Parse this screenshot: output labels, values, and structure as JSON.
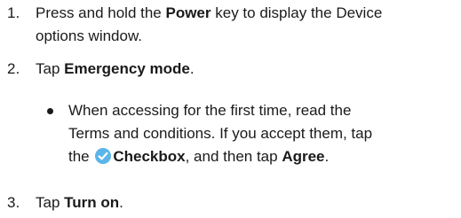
{
  "steps": [
    {
      "number": "1.",
      "text_1": "Press and hold the ",
      "bold_1": "Power",
      "text_2": " key to display the Device",
      "line_2": "options window."
    },
    {
      "number": "2.",
      "text_1": "Tap ",
      "bold_1": "Emergency mode",
      "text_2": "."
    },
    {
      "number": "3.",
      "text_1": "Tap ",
      "bold_1": "Turn on",
      "text_2": "."
    }
  ],
  "bullet": {
    "line_1": "When accessing for the first time, read the",
    "line_2": "Terms and conditions. If you accept them, tap",
    "line_3_text_1": "the ",
    "line_3_bold_1": "Checkbox",
    "line_3_text_2": ", and then tap ",
    "line_3_bold_2": "Agree",
    "line_3_text_3": ".",
    "icon": "checkbox-checked-icon",
    "icon_color": "#5bb5ea"
  }
}
